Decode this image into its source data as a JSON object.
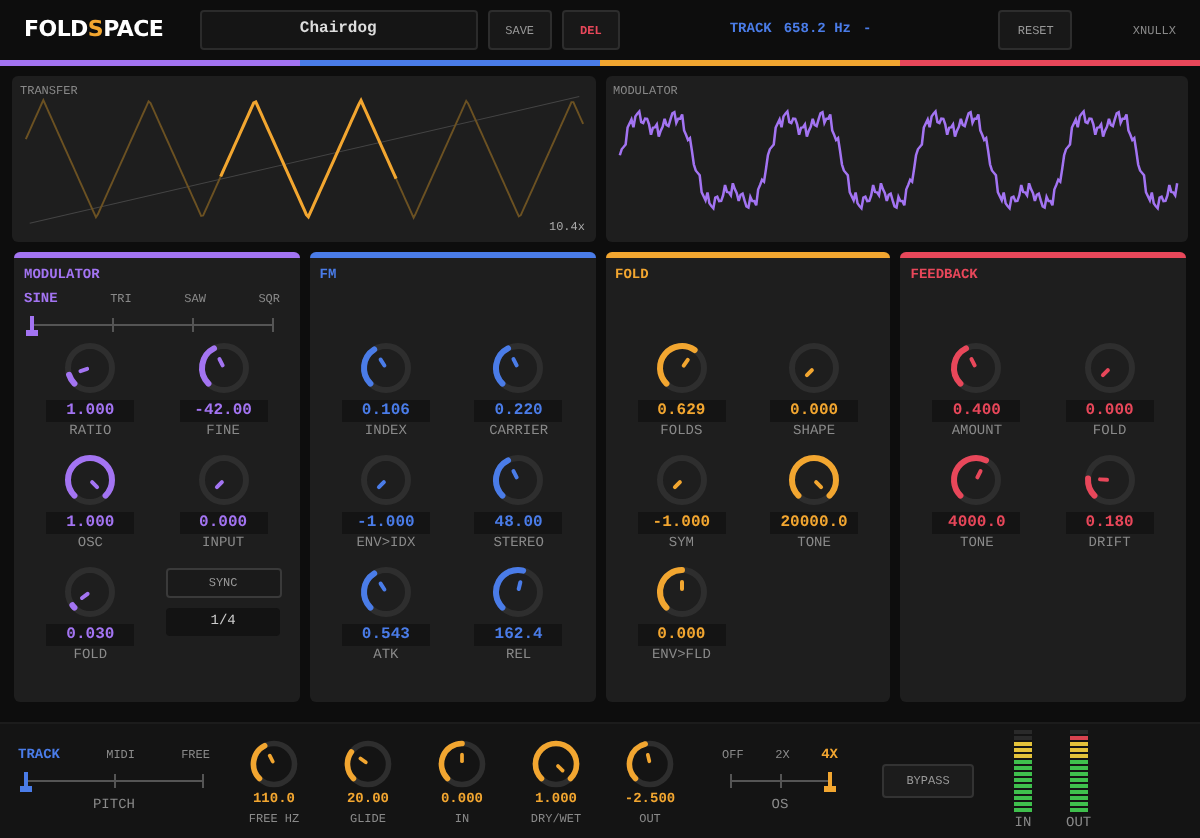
{
  "header": {
    "logo": [
      {
        "text": "FOLD",
        "accent": false
      },
      {
        "text": "S",
        "accent": true
      },
      {
        "text": "PACE",
        "accent": false
      }
    ],
    "preset": "Chairdog",
    "buttons": [
      {
        "label": "SAVE",
        "kind": "plain"
      },
      {
        "label": "DEL",
        "kind": "danger"
      }
    ],
    "track_label": "TRACK",
    "track_value": "658.2 Hz",
    "track_extra": "-",
    "reset": "RESET",
    "user": "XNULLX"
  },
  "scopes": [
    {
      "kind": "transfer",
      "label": "TRANSFER",
      "reading": "10.4x"
    },
    {
      "kind": "modulator",
      "label": "MODULATOR"
    }
  ],
  "panels": [
    {
      "title": "MODULATOR",
      "color": "#a374f2",
      "selector": {
        "options": [
          {
            "label": "SINE",
            "selected": true
          },
          {
            "label": "TRI",
            "selected": false
          },
          {
            "label": "SAW",
            "selected": false
          },
          {
            "label": "SQR",
            "selected": false
          }
        ]
      },
      "knobs": [
        {
          "label": "RATIO",
          "value": "1.000"
        },
        {
          "label": "FINE",
          "value": "-42.00"
        },
        {
          "label": "OSC",
          "value": "1.000"
        },
        {
          "label": "INPUT",
          "value": "0.000"
        },
        {
          "label": "FOLD",
          "value": "0.030"
        }
      ],
      "extras": [
        {
          "kind": "button",
          "label": "SYNC"
        },
        {
          "kind": "field",
          "label": "1/4"
        }
      ]
    },
    {
      "title": "FM",
      "color": "#4a7ce8",
      "knobs": [
        {
          "label": "INDEX",
          "value": "0.106"
        },
        {
          "label": "CARRIER",
          "value": "0.220"
        },
        {
          "label": "ENV>IDX",
          "value": "-1.000"
        },
        {
          "label": "STEREO",
          "value": "48.00"
        },
        {
          "label": "ATK",
          "value": "0.543"
        },
        {
          "label": "REL",
          "value": "162.4"
        }
      ]
    },
    {
      "title": "FOLD",
      "color": "#f2a630",
      "knobs": [
        {
          "label": "FOLDS",
          "value": "0.629"
        },
        {
          "label": "SHAPE",
          "value": "0.000"
        },
        {
          "label": "SYM",
          "value": "-1.000"
        },
        {
          "label": "TONE",
          "value": "20000.0"
        },
        {
          "label": "ENV>FLD",
          "value": "0.000"
        }
      ]
    },
    {
      "title": "FEEDBACK",
      "color": "#e8475a",
      "knobs": [
        {
          "label": "AMOUNT",
          "value": "0.400"
        },
        {
          "label": "FOLD",
          "value": "0.000"
        },
        {
          "label": "TONE",
          "value": "4000.0"
        },
        {
          "label": "DRIFT",
          "value": "0.180"
        }
      ]
    }
  ],
  "bottom": {
    "pitch": {
      "label": "PITCH",
      "options": [
        {
          "label": "TRACK",
          "selected": true
        },
        {
          "label": "MIDI",
          "selected": false
        },
        {
          "label": "FREE",
          "selected": false
        }
      ]
    },
    "knobs": [
      {
        "label": "FREE HZ",
        "value": "110.0"
      },
      {
        "label": "GLIDE",
        "value": "20.00"
      },
      {
        "label": "IN",
        "value": "0.000"
      },
      {
        "label": "DRY/WET",
        "value": "1.000"
      },
      {
        "label": "OUT",
        "value": "-2.500"
      }
    ],
    "os": {
      "label": "OS",
      "options": [
        {
          "label": "OFF",
          "selected": false
        },
        {
          "label": "2X",
          "selected": false
        },
        {
          "label": "4X",
          "selected": true
        }
      ]
    },
    "bypass": "BYPASS",
    "meters": [
      {
        "label": "IN",
        "level": 0.85
      },
      {
        "label": "OUT",
        "level": 0.95
      }
    ]
  }
}
